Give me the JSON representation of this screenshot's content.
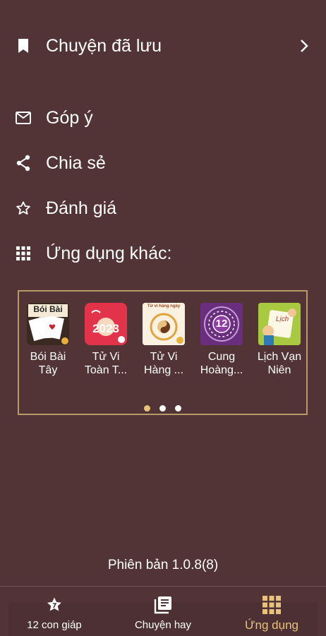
{
  "menu": {
    "saved_stories": "Chuyện đã lưu",
    "feedback": "Góp ý",
    "share": "Chia sẻ",
    "rate": "Đánh giá",
    "other_apps": "Ứng dụng khác:"
  },
  "apps": [
    {
      "line1": "Bói Bài",
      "line2": "Tây",
      "tile_text": "Bói Bài"
    },
    {
      "line1": "Tử Vi",
      "line2": "Toàn T...",
      "tile_text": "2023"
    },
    {
      "line1": "Tử Vi",
      "line2": "Hàng ...",
      "tile_text": "Tử vi hàng ngày"
    },
    {
      "line1": "Cung",
      "line2": "Hoàng...",
      "tile_text": "12"
    },
    {
      "line1": "Lịch Vạn",
      "line2": "Niên",
      "tile_text": "Lịch"
    }
  ],
  "pager": {
    "pages": 3,
    "current": 0
  },
  "version": "Phiên bản 1.0.8(8)",
  "tabs": [
    {
      "label": "12 con giáp",
      "icon": "star-icon"
    },
    {
      "label": "Chuyện hay",
      "icon": "book-icon"
    },
    {
      "label": "Ứng dụng",
      "icon": "grid-icon"
    }
  ],
  "colors": {
    "background": "#523437",
    "accent": "#e8c27c",
    "border": "#b89a6a"
  }
}
